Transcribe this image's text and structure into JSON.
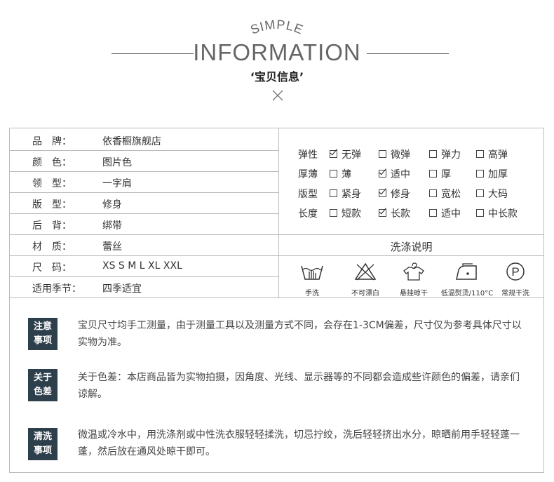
{
  "header": {
    "simple": "SIMPLE",
    "information": "INFORMATION",
    "subtitle": "‘宝贝信息’"
  },
  "attributes": [
    {
      "label": "品　牌：",
      "value": "依香橱旗舰店"
    },
    {
      "label": "颜　色：",
      "value": "图片色"
    },
    {
      "label": "领　型：",
      "value": "一字肩"
    },
    {
      "label": "版　型：",
      "value": "修身"
    },
    {
      "label": "后　背：",
      "value": "绑带"
    },
    {
      "label": "材　质：",
      "value": "蕾丝"
    },
    {
      "label": "尺　码：",
      "value": "XS S M L XL XXL"
    },
    {
      "label": "适用季节：",
      "value": "四季适宜"
    }
  ],
  "specs": [
    {
      "label": "弹性",
      "options": [
        {
          "text": "无弹",
          "checked": true
        },
        {
          "text": "微弹",
          "checked": false
        },
        {
          "text": "弹力",
          "checked": false
        },
        {
          "text": "高弹",
          "checked": false
        }
      ]
    },
    {
      "label": "厚薄",
      "options": [
        {
          "text": "薄",
          "checked": false
        },
        {
          "text": "适中",
          "checked": true
        },
        {
          "text": "厚",
          "checked": false
        },
        {
          "text": "加厚",
          "checked": false
        }
      ]
    },
    {
      "label": "版型",
      "options": [
        {
          "text": "紧身",
          "checked": false
        },
        {
          "text": "修身",
          "checked": true
        },
        {
          "text": "宽松",
          "checked": false
        },
        {
          "text": "大码",
          "checked": false
        }
      ]
    },
    {
      "label": "长度",
      "options": [
        {
          "text": "短款",
          "checked": false
        },
        {
          "text": "长款",
          "checked": true
        },
        {
          "text": "适中",
          "checked": false
        },
        {
          "text": "中长款",
          "checked": false
        }
      ]
    }
  ],
  "washing": {
    "title": "洗涤说明",
    "items": [
      {
        "icon": "hand-wash-icon",
        "label": "手洗"
      },
      {
        "icon": "no-bleach-icon",
        "label": "不可漂白"
      },
      {
        "icon": "hang-dry-icon",
        "label": "悬挂晾干"
      },
      {
        "icon": "low-iron-icon",
        "label": "低温熨烫/110°C"
      },
      {
        "icon": "dry-clean-icon",
        "label": "常规干洗",
        "glyph": "P"
      }
    ]
  },
  "notes": [
    {
      "tag": [
        "注意",
        "事项"
      ],
      "text": "宝贝尺寸均手工测量，由于测量工具以及测量方式不同，会存在1-3CM偏差，尺寸仅为参考具体尺寸以实物为准。"
    },
    {
      "tag": [
        "关于",
        "色差"
      ],
      "text": "关于色差：本店商品皆为实物拍摄，因角度、光线、显示器等的不同都会造成些许颜色的偏差，请亲们谅解。"
    },
    {
      "tag": [
        "清洗",
        "事项"
      ],
      "text": "微温或冷水中，用洗涤剂或中性洗衣服轻轻揉洗，切忌拧绞，洗后轻轻挤出水分，晾晒前用手轻轻蓬一蓬，然后放在通风处晾干即可。"
    }
  ],
  "colors": {
    "tag_bg": "#2e3f4c",
    "border": "#bbbbbb"
  }
}
